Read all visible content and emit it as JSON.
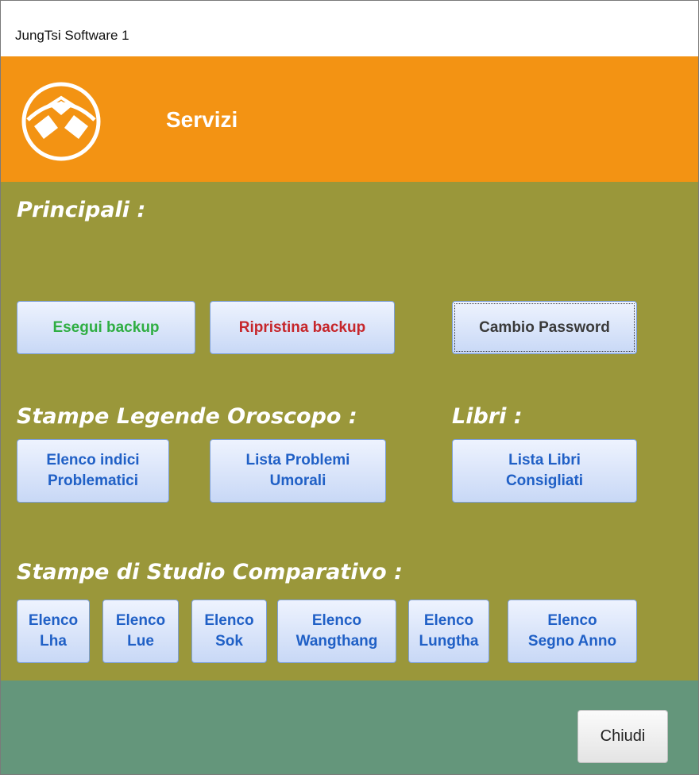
{
  "window": {
    "title": "JungTsi Software 1"
  },
  "header": {
    "title": "Servizi",
    "logo_icon": "endless-knot-logo"
  },
  "sections": {
    "principali": "Principali :",
    "stampe_legende": "Stampe Legende Oroscopo :",
    "libri": "Libri :",
    "stampe_studio": "Stampe di Studio Comparativo :"
  },
  "buttons": {
    "esegui_backup": "Esegui backup",
    "ripristina_backup": "Ripristina backup",
    "cambio_password": "Cambio Password",
    "elenco_indici": "Elenco indici\nProblematici",
    "lista_problemi": "Lista Problemi\nUmorali",
    "lista_libri": "Lista Libri\nConsigliati",
    "elenco_lha": "Elenco\nLha",
    "elenco_lue": "Elenco\nLue",
    "elenco_sok": "Elenco\nSok",
    "elenco_wangthang": "Elenco\nWangthang",
    "elenco_lungtha": "Elenco\nLungtha",
    "elenco_segno_anno": "Elenco\nSegno Anno",
    "chiudi": "Chiudi"
  },
  "colors": {
    "header": "#f39313",
    "panel": "#9a973a",
    "footer": "#64967b",
    "link_blue": "#2060c6",
    "backup_green": "#2fae43",
    "restore_red": "#c6262b"
  }
}
